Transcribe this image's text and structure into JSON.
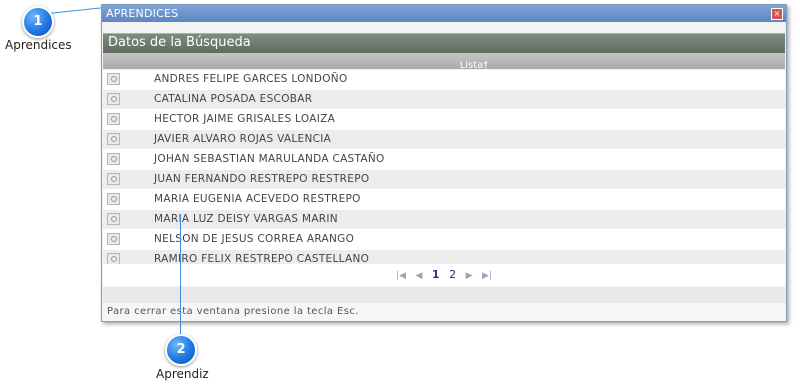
{
  "callouts": [
    {
      "number": "1",
      "label": "Aprendices"
    },
    {
      "number": "2",
      "label": "Aprendiz"
    }
  ],
  "window": {
    "title": "APRENDICES",
    "close_label": "×",
    "section_title": "Datos de la Búsqueda",
    "column_header": "Lista†",
    "rows": [
      "ANDRES FELIPE GARCES LONDOÑO",
      "CATALINA POSADA ESCOBAR",
      "HECTOR JAIME GRISALES LOAIZA",
      "JAVIER ALVARO ROJAS VALENCIA",
      "JOHAN SEBASTIAN MARULANDA CASTAÑO",
      "JUAN FERNANDO RESTREPO RESTREPO",
      "MARIA EUGENIA ACEVEDO RESTREPO",
      "MARIA LUZ DEISY VARGAS MARIN",
      "NELSON DE JESUS CORREA ARANGO",
      "RAMIRO FELIX RESTREPO CASTELLANO"
    ],
    "pager": {
      "first": "|◀",
      "prev": "◀",
      "pages": [
        "1",
        "2"
      ],
      "current_page": "1",
      "next": "▶",
      "last": "▶|"
    },
    "footer_text": "Para cerrar esta ventana presione la tecla Esc."
  },
  "colors": {
    "titlebar": "#6f96cc",
    "section_header": "#6b786c",
    "callout": "#1f78e0"
  }
}
